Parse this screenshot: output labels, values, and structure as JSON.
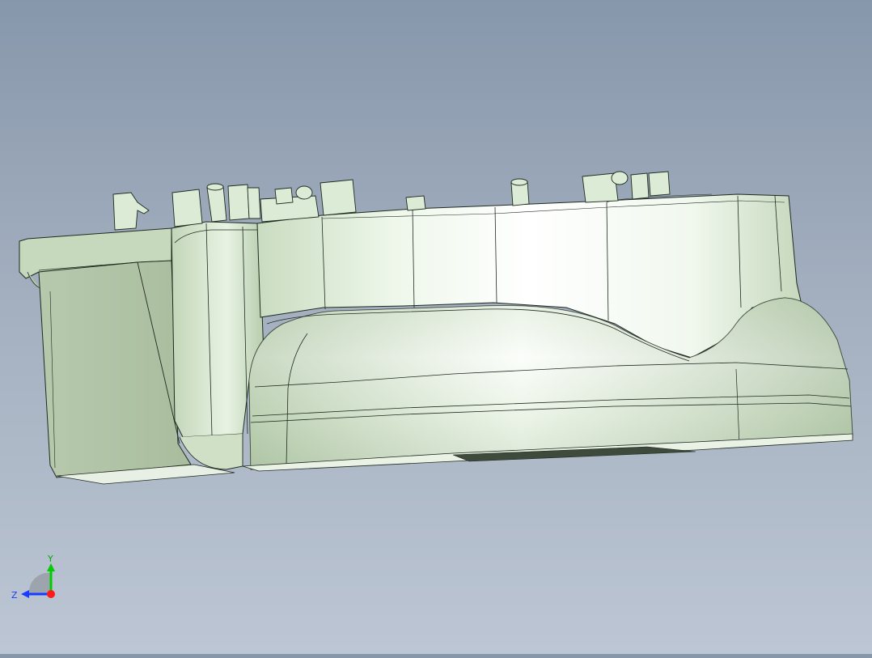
{
  "viewport": {
    "background_top": "#8797ab",
    "background_bottom": "#bcc6d4",
    "model_color": "#d9ebd3",
    "model_shadow": "#9fb797",
    "edge_color": "#1f2a1f"
  },
  "triad": {
    "y_label": "Y",
    "z_label": "Z",
    "y_color": "#00cc00",
    "z_color": "#1a3cff",
    "x_color": "#ff1a1a"
  }
}
